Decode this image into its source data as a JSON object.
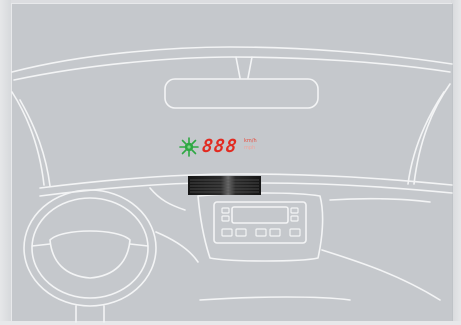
{
  "hud": {
    "icon": "satellite-icon",
    "digits": "888",
    "units": [
      "km/h",
      "mph"
    ]
  },
  "colors": {
    "background": "#c5c8cc",
    "outline": "#f2f3f4",
    "hud_digits": "#e22a20",
    "hud_icon": "#2ea843",
    "projector": "#1a1a1a"
  },
  "parts": [
    "windshield",
    "rear-view-mirror",
    "head-up-display",
    "hud-projector",
    "dashboard",
    "steering-wheel",
    "center-console"
  ]
}
